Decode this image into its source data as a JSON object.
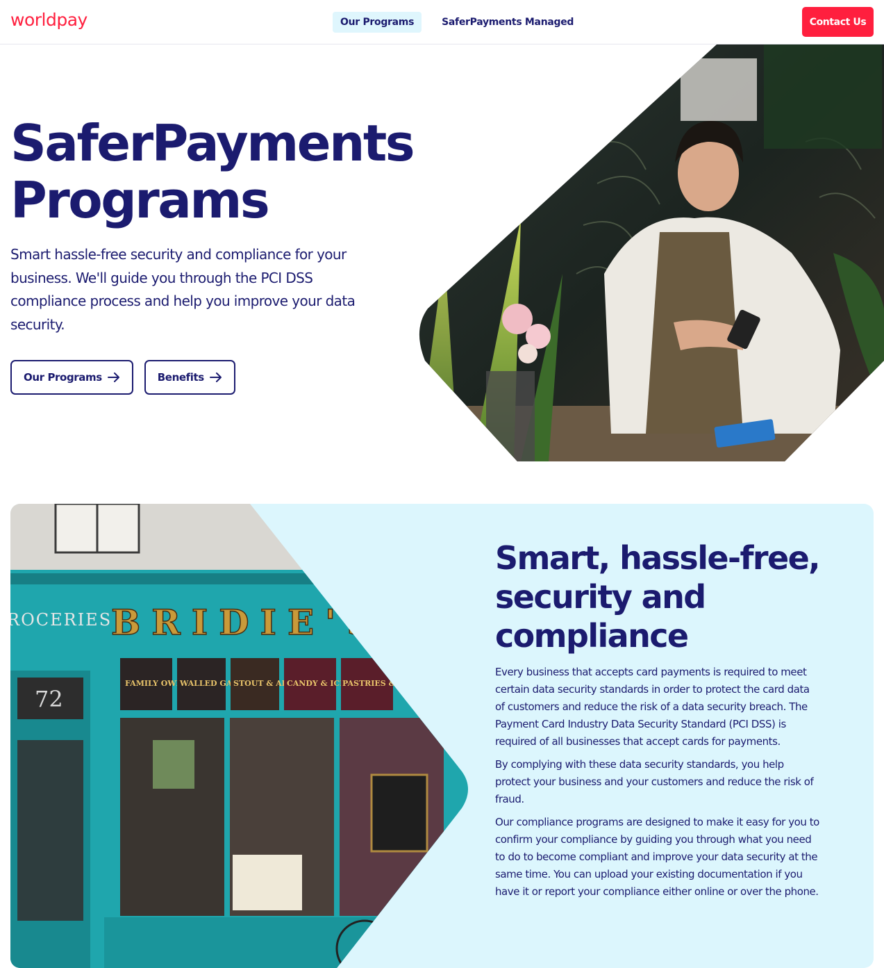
{
  "header": {
    "logo": "worldpay",
    "nav": [
      {
        "label": "Our Programs",
        "active": true
      },
      {
        "label": "SaferPayments Managed",
        "active": false
      }
    ],
    "contact_label": "Contact Us"
  },
  "hero": {
    "title_line1": "SaferPayments",
    "title_line2": "Programs",
    "subtitle": "Smart hassle-free security and compliance for your business. We'll guide you through the PCI DSS compliance process and help you improve your data security.",
    "buttons": [
      {
        "label": "Our Programs",
        "icon": "arrow-right-icon"
      },
      {
        "label": "Benefits",
        "icon": "arrow-right-icon"
      }
    ]
  },
  "section": {
    "title": "Smart, hassle-free, security and compliance",
    "paragraphs": [
      "Every business that accepts card payments is required to meet certain data security standards in order to protect the card data of customers and reduce the risk of a data security breach. The Payment Card Industry Data Security Standard (PCI DSS) is required of all businesses that accept cards for payments.",
      "By complying with these data security standards, you help protect your business and your customers and reduce the risk of fraud.",
      "Our compliance programs are designed to make it easy for you to confirm your compliance by guiding you through what you need to do to become compliant and improve your data security at the same time. You can upload your existing documentation if you have it or report your compliance either online or over the phone."
    ],
    "storefront": {
      "sign": "BRIDIE'S",
      "sign_left": "ROCERIES",
      "number": "72",
      "panels": [
        "FAMILY OWNED",
        "WALLED GARDEN",
        "STOUT & ALES",
        "CANDY & ICE CREAM",
        "PASTRIES & CAKES"
      ]
    }
  },
  "colors": {
    "brand_red": "#ff1f3e",
    "navy": "#1b1b6f",
    "light_blue": "#dcf6fd",
    "teal": "#1fa6ad"
  }
}
